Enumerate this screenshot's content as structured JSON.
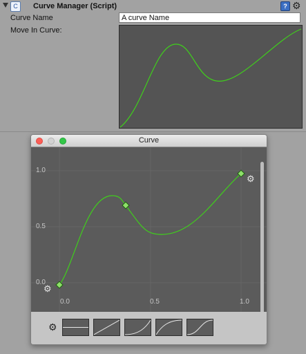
{
  "inspector": {
    "component_title": "Curve Manager (Script)",
    "script_icon": "script-icon",
    "help_icon": "help-book-icon",
    "settings_icon": "gear-icon",
    "fields": {
      "curve_name_label": "Curve Name",
      "curve_name_value": "A curve Name",
      "move_in_curve_label": "Move In Curve:"
    }
  },
  "curve_window": {
    "title": "Curve",
    "axis_labels": {
      "y": [
        "1.0",
        "0.5",
        "0.0"
      ],
      "x": [
        "0.0",
        "0.5",
        "1.0"
      ]
    },
    "keyframes": [
      {
        "time": 0.0,
        "value": 0.0
      },
      {
        "time": 0.36,
        "value": 0.7
      },
      {
        "time": 1.0,
        "value": 1.0
      }
    ],
    "presets": [
      "constant",
      "linear",
      "ease-in",
      "ease-out",
      "ease-in-out"
    ]
  },
  "colors": {
    "curve": "#3fd01b",
    "graph_background": "#5b5b5b",
    "panel_background": "#a2a2a2"
  }
}
